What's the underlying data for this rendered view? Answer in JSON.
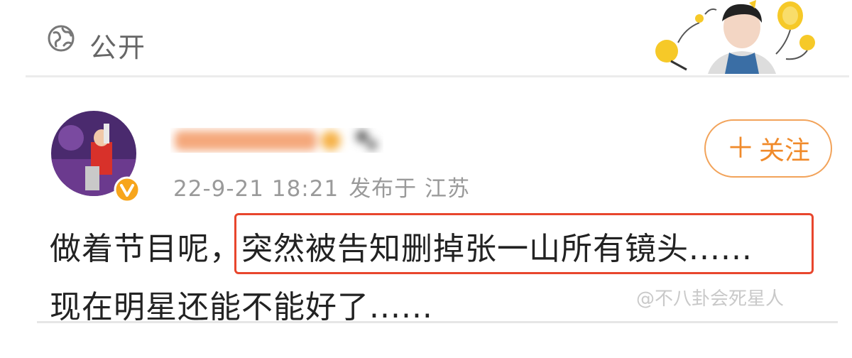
{
  "header": {
    "visibility_icon": "globe-icon",
    "visibility_label": "公开"
  },
  "post": {
    "author_verified_icon": "verified-badge-icon",
    "timestamp": "22-9-21 18:21",
    "location_text": "发布于 江苏",
    "follow_label": "关注",
    "follow_icon": "plus-icon",
    "text_line1_prefix": "做着节目呢，",
    "text_line1_highlight": "突然被告知删掉张一山所有镜头......",
    "text_line2": "现在明星还能不能好了......",
    "highlight_color": "#e8462d",
    "accent_color": "#f08a2a"
  },
  "watermark": "@不八卦会死星人"
}
